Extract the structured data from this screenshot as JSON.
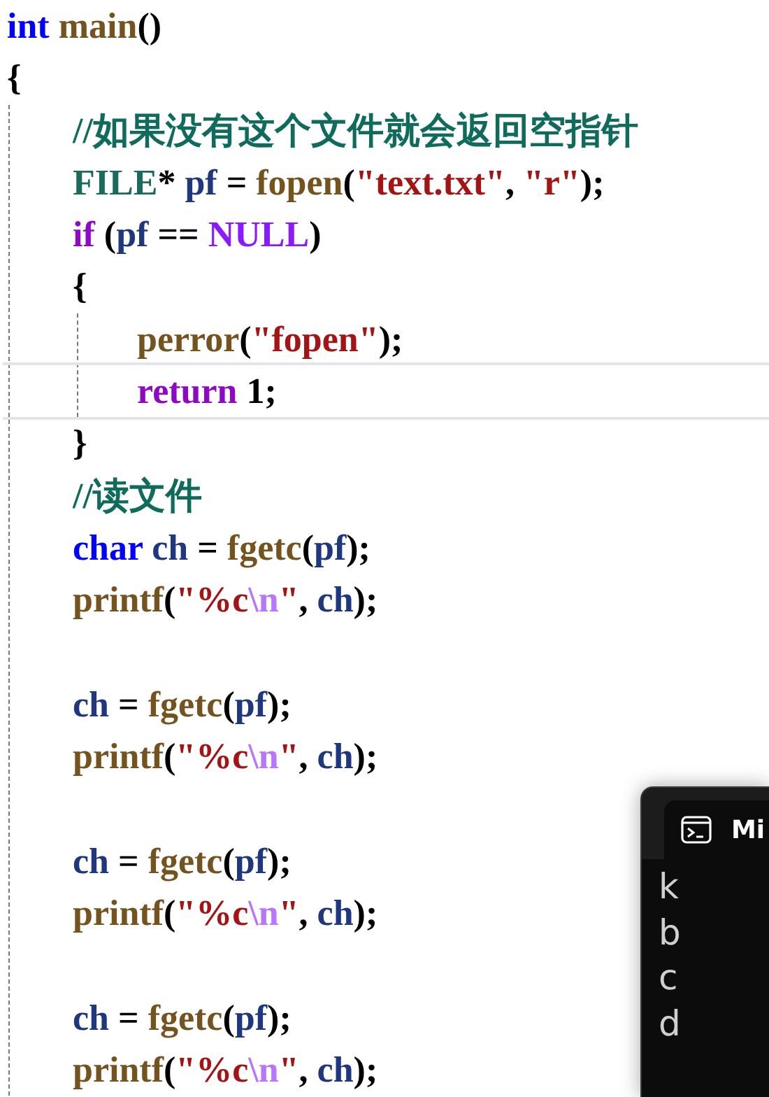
{
  "editor": {
    "lines": [
      {
        "tokens": [
          {
            "kind": "keyword",
            "text": "int "
          },
          {
            "kind": "func",
            "text": "main"
          },
          {
            "kind": "plain",
            "text": "()"
          }
        ]
      },
      {
        "tokens": [
          {
            "kind": "plain",
            "text": "{"
          }
        ]
      },
      {
        "kind": "block",
        "children": [
          {
            "tokens": [
              {
                "kind": "comment",
                "text": "//如果没有这个文件就会返回空指针"
              }
            ]
          },
          {
            "tokens": [
              {
                "kind": "type",
                "text": "FILE"
              },
              {
                "kind": "plain",
                "text": "* "
              },
              {
                "kind": "var",
                "text": "pf"
              },
              {
                "kind": "plain",
                "text": " = "
              },
              {
                "kind": "func",
                "text": "fopen"
              },
              {
                "kind": "plain",
                "text": "("
              },
              {
                "kind": "str",
                "text": "\"text.txt\""
              },
              {
                "kind": "plain",
                "text": ", "
              },
              {
                "kind": "str",
                "text": "\"r\""
              },
              {
                "kind": "plain",
                "text": ");"
              }
            ]
          },
          {
            "tokens": [
              {
                "kind": "control",
                "text": "if"
              },
              {
                "kind": "plain",
                "text": " ("
              },
              {
                "kind": "var",
                "text": "pf"
              },
              {
                "kind": "plain",
                "text": " == "
              },
              {
                "kind": "macro",
                "text": "NULL"
              },
              {
                "kind": "plain",
                "text": ")"
              }
            ]
          },
          {
            "tokens": [
              {
                "kind": "plain",
                "text": "{"
              }
            ]
          },
          {
            "kind": "block",
            "children": [
              {
                "tokens": [
                  {
                    "kind": "func",
                    "text": "perror"
                  },
                  {
                    "kind": "plain",
                    "text": "("
                  },
                  {
                    "kind": "str",
                    "text": "\"fopen\""
                  },
                  {
                    "kind": "plain",
                    "text": ");"
                  }
                ]
              },
              {
                "current": true,
                "tokens": [
                  {
                    "kind": "control",
                    "text": "return"
                  },
                  {
                    "kind": "plain",
                    "text": " 1;"
                  }
                ]
              }
            ]
          },
          {
            "tokens": [
              {
                "kind": "plain",
                "text": "}"
              }
            ]
          },
          {
            "tokens": [
              {
                "kind": "comment",
                "text": "//读文件"
              }
            ]
          },
          {
            "tokens": [
              {
                "kind": "keyword",
                "text": "char "
              },
              {
                "kind": "var",
                "text": "ch"
              },
              {
                "kind": "plain",
                "text": " = "
              },
              {
                "kind": "func",
                "text": "fgetc"
              },
              {
                "kind": "plain",
                "text": "("
              },
              {
                "kind": "var",
                "text": "pf"
              },
              {
                "kind": "plain",
                "text": ");"
              }
            ]
          },
          {
            "tokens": [
              {
                "kind": "func",
                "text": "printf"
              },
              {
                "kind": "plain",
                "text": "("
              },
              {
                "kind": "str",
                "text": "\"%c"
              },
              {
                "kind": "escape",
                "text": "\\n"
              },
              {
                "kind": "str",
                "text": "\""
              },
              {
                "kind": "plain",
                "text": ", "
              },
              {
                "kind": "var",
                "text": "ch"
              },
              {
                "kind": "plain",
                "text": ");"
              }
            ]
          },
          {
            "kind": "blank"
          },
          {
            "tokens": [
              {
                "kind": "var",
                "text": "ch"
              },
              {
                "kind": "plain",
                "text": " = "
              },
              {
                "kind": "func",
                "text": "fgetc"
              },
              {
                "kind": "plain",
                "text": "("
              },
              {
                "kind": "var",
                "text": "pf"
              },
              {
                "kind": "plain",
                "text": ");"
              }
            ]
          },
          {
            "tokens": [
              {
                "kind": "func",
                "text": "printf"
              },
              {
                "kind": "plain",
                "text": "("
              },
              {
                "kind": "str",
                "text": "\"%c"
              },
              {
                "kind": "escape",
                "text": "\\n"
              },
              {
                "kind": "str",
                "text": "\""
              },
              {
                "kind": "plain",
                "text": ", "
              },
              {
                "kind": "var",
                "text": "ch"
              },
              {
                "kind": "plain",
                "text": ");"
              }
            ]
          },
          {
            "kind": "blank"
          },
          {
            "tokens": [
              {
                "kind": "var",
                "text": "ch"
              },
              {
                "kind": "plain",
                "text": " = "
              },
              {
                "kind": "func",
                "text": "fgetc"
              },
              {
                "kind": "plain",
                "text": "("
              },
              {
                "kind": "var",
                "text": "pf"
              },
              {
                "kind": "plain",
                "text": ");"
              }
            ]
          },
          {
            "tokens": [
              {
                "kind": "func",
                "text": "printf"
              },
              {
                "kind": "plain",
                "text": "("
              },
              {
                "kind": "str",
                "text": "\"%c"
              },
              {
                "kind": "escape",
                "text": "\\n"
              },
              {
                "kind": "str",
                "text": "\""
              },
              {
                "kind": "plain",
                "text": ", "
              },
              {
                "kind": "var",
                "text": "ch"
              },
              {
                "kind": "plain",
                "text": ");"
              }
            ]
          },
          {
            "kind": "blank"
          },
          {
            "tokens": [
              {
                "kind": "var",
                "text": "ch"
              },
              {
                "kind": "plain",
                "text": " = "
              },
              {
                "kind": "func",
                "text": "fgetc"
              },
              {
                "kind": "plain",
                "text": "("
              },
              {
                "kind": "var",
                "text": "pf"
              },
              {
                "kind": "plain",
                "text": ");"
              }
            ]
          },
          {
            "tokens": [
              {
                "kind": "func",
                "text": "printf"
              },
              {
                "kind": "plain",
                "text": "("
              },
              {
                "kind": "str",
                "text": "\"%c"
              },
              {
                "kind": "escape",
                "text": "\\n"
              },
              {
                "kind": "str",
                "text": "\""
              },
              {
                "kind": "plain",
                "text": ", "
              },
              {
                "kind": "var",
                "text": "ch"
              },
              {
                "kind": "plain",
                "text": ");"
              }
            ]
          }
        ]
      }
    ]
  },
  "console": {
    "tab_title": "Mi",
    "output": [
      "k",
      "b",
      "c",
      "d"
    ]
  }
}
